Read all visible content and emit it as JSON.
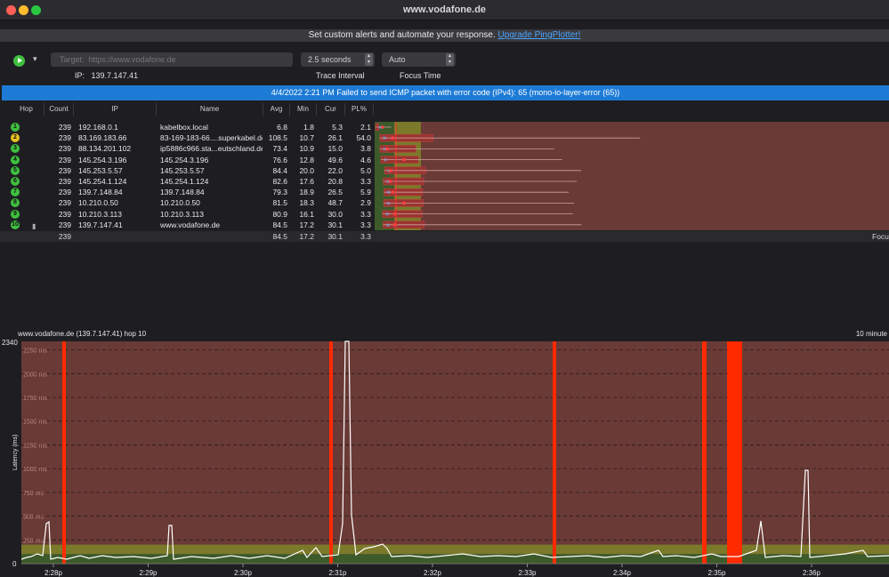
{
  "window": {
    "title": "www.vodafone.de"
  },
  "promo": {
    "text": "Set custom alerts and automate your response.",
    "link": "Upgrade PingPlotter!"
  },
  "toolbar": {
    "target_placeholder": "Target:  https://www.vodafone.de",
    "ip_label": "IP:",
    "ip_value": "139.7.147.41",
    "trace_interval_value": "2.5 seconds",
    "trace_interval_label": "Trace Interval",
    "focus_time_value": "Auto",
    "focus_time_label": "Focus Time"
  },
  "alert": {
    "text": "4/4/2022 2:21 PM Failed to send ICMP packet with error code (IPv4): 65 (mono-io-layer-error (65))"
  },
  "table": {
    "headers": {
      "hop": "Hop",
      "count": "Count",
      "ip": "IP",
      "name": "Name",
      "avg": "Avg",
      "min": "Min",
      "cur": "Cur",
      "pl": "PL%"
    },
    "rows": [
      {
        "hop": "1",
        "status": "good",
        "count": "239",
        "ip": "192.168.0.1",
        "name": "kabelbox.local",
        "avg": "6.8",
        "min": "1.8",
        "cur": "5.3",
        "pl": "2.1"
      },
      {
        "hop": "2",
        "status": "warn",
        "count": "239",
        "ip": "83.169.183.66",
        "name": "83-169-183-66....superkabel.de",
        "avg": "108.5",
        "min": "10.7",
        "cur": "26.1",
        "pl": "54.0"
      },
      {
        "hop": "3",
        "status": "good",
        "count": "239",
        "ip": "88.134.201.102",
        "name": "ip5886c966.sta...eutschland.de",
        "avg": "73.4",
        "min": "10.9",
        "cur": "15.0",
        "pl": "3.8"
      },
      {
        "hop": "4",
        "status": "good",
        "count": "239",
        "ip": "145.254.3.196",
        "name": "145.254.3.196",
        "avg": "76.6",
        "min": "12.8",
        "cur": "49.6",
        "pl": "4.6"
      },
      {
        "hop": "5",
        "status": "good",
        "count": "239",
        "ip": "145.253.5.57",
        "name": "145.253.5.57",
        "avg": "84.4",
        "min": "20.0",
        "cur": "22.0",
        "pl": "5.0"
      },
      {
        "hop": "6",
        "status": "good",
        "count": "239",
        "ip": "145.254.1.124",
        "name": "145.254.1.124",
        "avg": "82.6",
        "min": "17.6",
        "cur": "20.8",
        "pl": "3.3"
      },
      {
        "hop": "7",
        "status": "good",
        "count": "239",
        "ip": "139.7.148.84",
        "name": "139.7.148.84",
        "avg": "79.3",
        "min": "18.9",
        "cur": "26.5",
        "pl": "5.9"
      },
      {
        "hop": "8",
        "status": "good",
        "count": "239",
        "ip": "10.210.0.50",
        "name": "10.210.0.50",
        "avg": "81.5",
        "min": "18.3",
        "cur": "48.7",
        "pl": "2.9"
      },
      {
        "hop": "9",
        "status": "good",
        "count": "239",
        "ip": "10.210.3.113",
        "name": "10.210.3.113",
        "avg": "80.9",
        "min": "16.1",
        "cur": "30.0",
        "pl": "3.3"
      },
      {
        "hop": "10",
        "status": "good",
        "count": "239",
        "ip": "139.7.147.41",
        "name": "www.vodafone.de",
        "avg": "84.5",
        "min": "17.2",
        "cur": "30.1",
        "pl": "3.3"
      }
    ],
    "summary": {
      "count": "239",
      "avg": "84.5",
      "min": "17.2",
      "cur": "30.1",
      "pl": "3.3",
      "focus_label": "Focu"
    }
  },
  "colors": {
    "good": "#3fbf3f",
    "warn": "#e8c020",
    "alert_bar": "#1d7bd6",
    "loss": "#ff2a00",
    "bg_bad": "#6a3a36",
    "bg_ok": "#7a7a2a",
    "bg_good": "#3d5a2a"
  },
  "graph": {
    "title": "www.vodafone.de (139.7.147.41) hop 10",
    "range_label": "10 minute",
    "ylabel": "Latency (ms)",
    "ymax_label": "2340",
    "yzero_label": "0",
    "ytick_labels": [
      "2250 ms",
      "2000 ms",
      "1750 ms",
      "1500 ms",
      "1250 ms",
      "1000 ms",
      "750 ms",
      "500 ms",
      "250 ms"
    ],
    "xtick_labels": [
      "2:28p",
      "2:29p",
      "2:30p",
      "2:31p",
      "2:32p",
      "2:33p",
      "2:34p",
      "2:35p",
      "2:36p"
    ]
  }
}
